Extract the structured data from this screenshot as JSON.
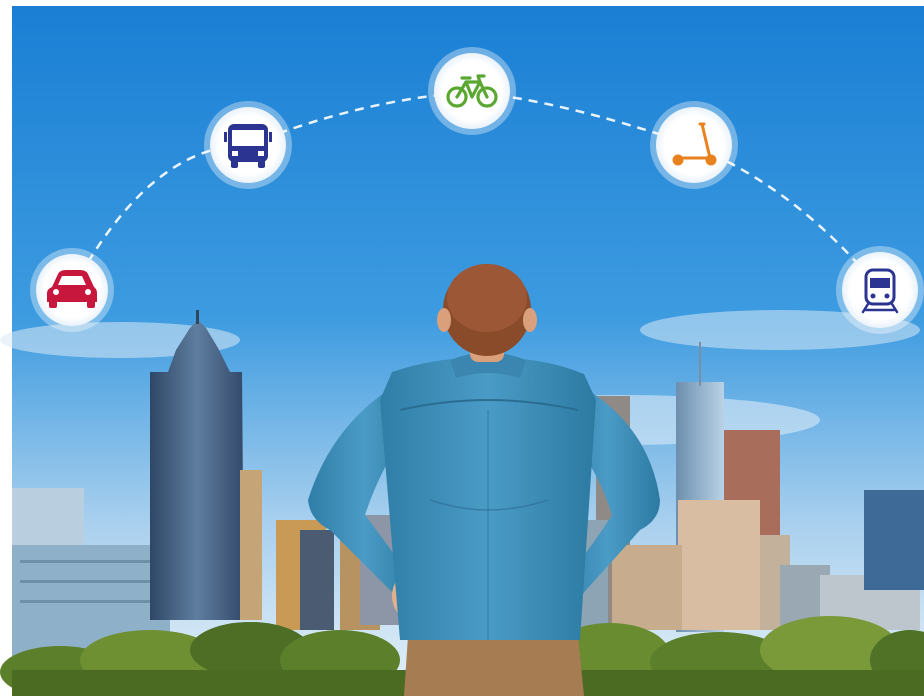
{
  "scene": {
    "description_icons": [
      {
        "name": "car-icon",
        "color": "#c8173c"
      },
      {
        "name": "bus-icon",
        "color": "#2b3591"
      },
      {
        "name": "bicycle-icon",
        "color": "#5aa832"
      },
      {
        "name": "kick-scooter-icon",
        "color": "#e8821e"
      },
      {
        "name": "train-icon",
        "color": "#2b3591"
      }
    ],
    "colors": {
      "sky_top": "#1f86d6",
      "sky_bottom": "#dcecf7",
      "shirt": "#3f8fb8",
      "pants": "#a67c52",
      "hair": "#8a4b2a",
      "trees": "#5b7f2a"
    }
  }
}
